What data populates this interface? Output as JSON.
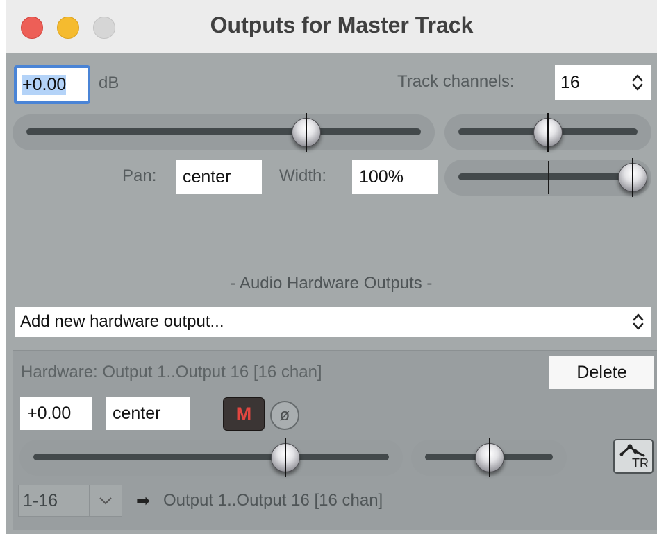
{
  "window": {
    "title": "Outputs for Master Track"
  },
  "master": {
    "volume_value": "+0.00",
    "volume_unit": "dB",
    "track_channels_label": "Track channels:",
    "track_channels_value": "16",
    "pan_label": "Pan:",
    "pan_value": "center",
    "width_label": "Width:",
    "width_value": "100%",
    "volume_fader_level": 0.72,
    "pan_knob_position": 0.5,
    "width_knob_position": 1.0
  },
  "hardware": {
    "section_title": "-  Audio Hardware Outputs  -",
    "add_output_label": "Add new hardware output...",
    "output_title": "Hardware: Output 1..Output 16 [16 chan]",
    "delete_label": "Delete",
    "volume_value": "+0.00",
    "pan_value": "center",
    "mute_label": "M",
    "phase_label": "ø",
    "envelope_label": "TR",
    "channel_range": "1-16",
    "arrow": "➡",
    "destination": "Output 1..Output 16 [16 chan]",
    "volume_fader_level": 0.72,
    "pan_knob_position": 0.5
  },
  "colors": {
    "mute_text": "#e24640",
    "selection_highlight": "#b4d3f8",
    "focus_ring": "#4a84d6"
  }
}
